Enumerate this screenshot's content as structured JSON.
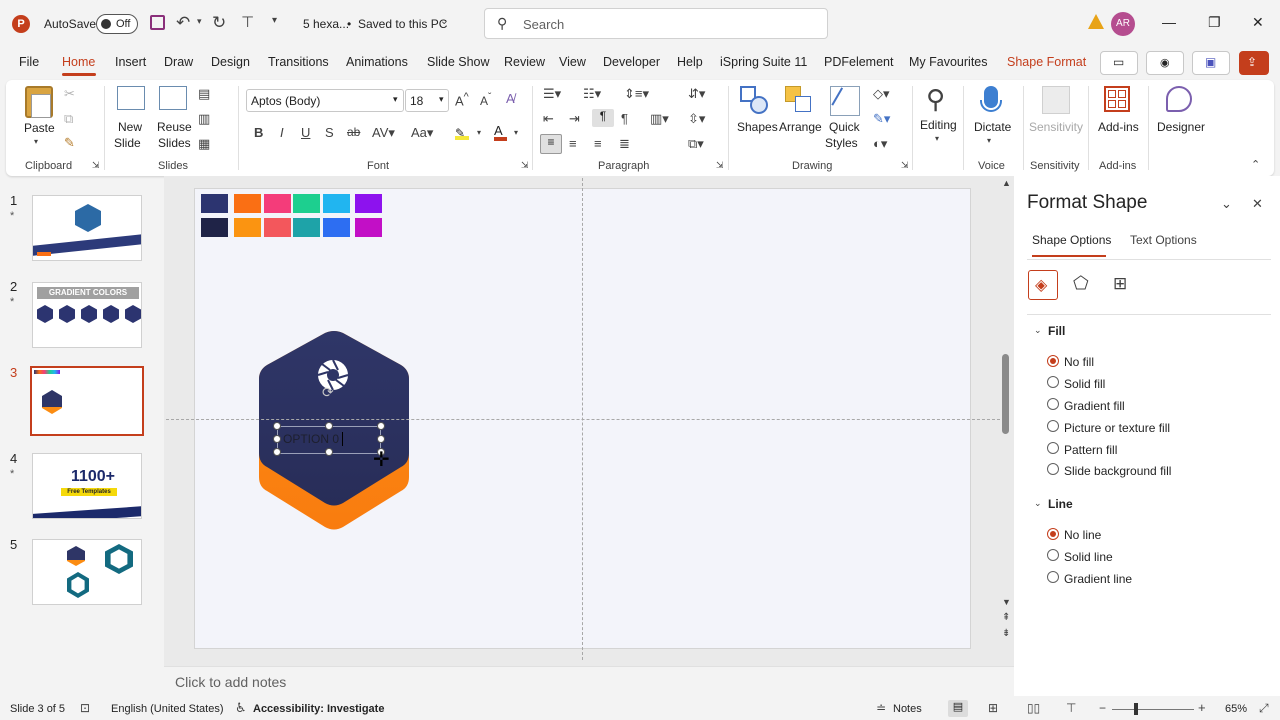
{
  "titlebar": {
    "autosave_label": "AutoSave",
    "autosave_state": "Off",
    "file_name": "5 hexa...",
    "save_status": "Saved to this PC",
    "search_placeholder": "Search",
    "avatar_initials": "AR"
  },
  "menu": {
    "tabs": [
      "File",
      "Home",
      "Insert",
      "Draw",
      "Design",
      "Transitions",
      "Animations",
      "Slide Show",
      "Review",
      "View",
      "Developer",
      "Help",
      "iSpring Suite 11",
      "PDFelement",
      "My Favourites",
      "Shape Format"
    ],
    "active_tab": "Home"
  },
  "ribbon": {
    "clipboard": {
      "paste": "Paste",
      "group": "Clipboard"
    },
    "slides": {
      "new_slide": "New",
      "new_slide2": "Slide",
      "reuse": "Reuse",
      "reuse2": "Slides",
      "group": "Slides"
    },
    "font": {
      "font_name": "Aptos (Body)",
      "font_size": "18",
      "group": "Font"
    },
    "paragraph": {
      "group": "Paragraph"
    },
    "drawing": {
      "shapes": "Shapes",
      "arrange": "Arrange",
      "quick_styles": "Quick",
      "quick_styles2": "Styles",
      "group": "Drawing"
    },
    "editing": {
      "label": "Editing"
    },
    "voice": {
      "dictate": "Dictate",
      "group": "Voice"
    },
    "sensitivity": {
      "label": "Sensitivity",
      "group": "Sensitivity"
    },
    "addins": {
      "label": "Add-ins",
      "group": "Add-ins"
    },
    "designer": {
      "label": "Designer"
    }
  },
  "thumbnails": [
    {
      "num": "1",
      "star": "*"
    },
    {
      "num": "2",
      "star": "*",
      "title": "GRADIENT COLORS"
    },
    {
      "num": "3",
      "star": ""
    },
    {
      "num": "4",
      "star": "*",
      "title": "1100+",
      "subtitle": "Free Templates"
    },
    {
      "num": "5",
      "star": ""
    }
  ],
  "slide": {
    "swatches_row1": [
      "#2c3470",
      "#fa6f14",
      "#f43c7a",
      "#1dcf8f",
      "#21b5f0",
      "#8d12ee"
    ],
    "swatches_row2": [
      "#1f2347",
      "#fb9411",
      "#f3575c",
      "#1ea3a8",
      "#2d6ef2",
      "#c20fc6"
    ],
    "text_box": "OPTION 0",
    "hex_color_top": "#2e3566",
    "hex_color_bottom": "#fb8c12"
  },
  "notes": {
    "placeholder": "Click to add notes"
  },
  "format_pane": {
    "title": "Format Shape",
    "tab_shape": "Shape Options",
    "tab_text": "Text Options",
    "fill_header": "Fill",
    "fill_options": [
      "No fill",
      "Solid fill",
      "Gradient fill",
      "Picture or texture fill",
      "Pattern fill",
      "Slide background fill"
    ],
    "fill_selected": 0,
    "line_header": "Line",
    "line_options": [
      "No line",
      "Solid line",
      "Gradient line"
    ],
    "line_selected": 0
  },
  "status": {
    "slide_of": "Slide 3 of 5",
    "language": "English (United States)",
    "accessibility": "Accessibility: Investigate",
    "notes": "Notes",
    "zoom": "65%"
  },
  "colors": {
    "accent": "#c43e1c"
  }
}
